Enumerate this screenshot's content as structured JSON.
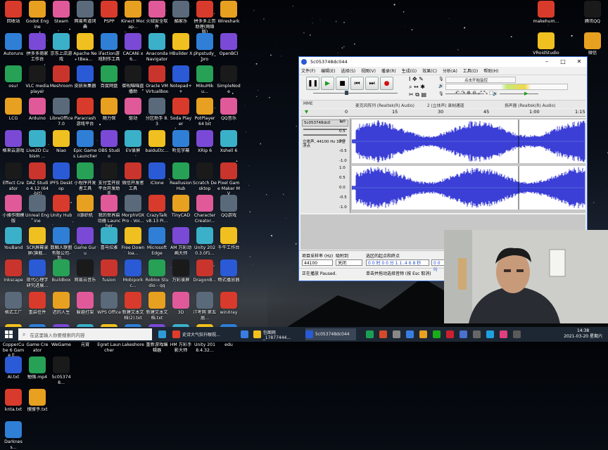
{
  "desktop_icons": [
    [
      "回收站",
      "Autoruns",
      "osu!",
      "LCG",
      "格来云游戏",
      "Effect Creator",
      "小雅作图模版",
      "YouBand",
      "Inkscape",
      "格式工厂",
      "CopperCube 6 Game E...",
      "AI.txt",
      "knta.txt",
      "Darkness..."
    ],
    [
      "Godot Engine",
      "拼多多商家工作台",
      "VLC media player",
      "Arduino",
      "Live2D Cubism ...",
      "DAZ Studio 4.12 (64-bit)",
      "Unreal Engine",
      "SCR屏幕录屏(旗舰...",
      "现代心理学研究进展...",
      "重启任件",
      "Game Creator",
      "勉强.mp4",
      "搜搜予.txt"
    ],
    [
      "Steam",
      "京东上店游戏",
      "Meshroom",
      "LibreOffice 7.0",
      "Niao",
      "IPFS Desktop",
      "Unity Hub",
      "数触人联盟有限公司-加...",
      "Buildbox",
      "迟的人生",
      "WeGame",
      "5c053748..."
    ],
    [
      "网易有道词典",
      "Apache NetBea...",
      "皮肤采集器",
      "Paracrash游戏平台",
      "Epic Games Launcher",
      "小程序开发者工具",
      "II源织机",
      "Game Guru",
      "网易云音乐",
      "躲避打架",
      "元宵"
    ],
    [
      "PSPP",
      "iFaction游戏制作工具",
      "百度网盘",
      "随力保",
      "OBS Studio",
      "支付宝开放平台开发助手",
      "我的世界启动器 Launcher",
      "喜马拉雅",
      "fusion",
      "WPS Office",
      "Egret Launcher"
    ],
    [
      "Kinect Mocap...",
      "CACANi x6...",
      "御视喵喵直播助",
      "驱动",
      "EV录屏",
      "微信开发者工具",
      "MorphVOX Pro - Voi...",
      "Free Downloa...",
      "Mobiporkc...",
      "新建文本文档(2).txt",
      "Lakeshore"
    ],
    [
      "火绒安全软件",
      "Anaconda Navigator",
      "Oracle VM VirtualBox",
      "分区助手 8.3",
      "baiduEtc...",
      "iClone",
      "CrazyTalk v8.13 Pi...",
      "Microsoft Edge",
      "Roblox Studio - qq",
      "新建文本文档.txt",
      "重新游戏编辑器"
    ],
    [
      "酷家乐",
      "HBuilder X",
      "Notepad++",
      "Soda Player",
      "听见字幕",
      "Reallusion Hub",
      "TinyCAD",
      "AM 万彩动画大师",
      "万彩录屏",
      "3D",
      "HM 万彩手影大师"
    ],
    [
      "拼多多上页助理(网络版)",
      "phpstudy_pro",
      "MikuMiku...",
      "PotPlayer 64 bit",
      "XRip 6",
      "Scratch Desktop",
      "Character Creator...",
      "Unity 2020.3.0f1...",
      "DragonB...",
      "iT考网 第五届...",
      "Unity 2018.4.32..."
    ],
    [
      "Wireshark",
      "OpenBCI",
      "SimpleNode",
      "QQ音乐",
      "Xshell 6",
      "Pixel Game Maker MV",
      "QQ游戏",
      "千牛工作台",
      "畅式播放器",
      "winXray",
      "edu"
    ]
  ],
  "right_icons": [
    "makehum...",
    "腾讯QQ",
    "VRoidStudio",
    "微信"
  ],
  "aud": {
    "title": "5c053748dc044",
    "menus": [
      "文件(F)",
      "编辑(E)",
      "选择(S)",
      "视图(V)",
      "播录(R)",
      "生成(G)",
      "效果(C)",
      "分析(A)",
      "工具(O)",
      "帮助(H)"
    ],
    "host": "MME",
    "rec_dev": "麦克风阵列 (Realtek(R) Audio)",
    "rec_ch": "2 (立体声) 录制通道",
    "play_dev": "扬声器 (Realtek(R) Audio)",
    "meter_label": "点击开始监控",
    "ruler": [
      "0",
      "15",
      "30",
      "45",
      "1:00",
      "1:15"
    ],
    "track_name": "5c053748dc0",
    "track_info": "立体声, 44100 Hz 32位浮点",
    "scale": [
      "1.0",
      "0.5",
      "0.0",
      "-0.5",
      "-1.0"
    ],
    "rate_label": "项目采样率 (Hz)",
    "rate_value": "44100",
    "snap_label": "吸附到",
    "snap_value": "关闭",
    "sel_label": "选区的起点和终点",
    "sel_start": "0 0 时 0 0 分 1 1 .4 6 8 秒",
    "sel_end": "0 0 时",
    "status_left": "正在播放 Paused.",
    "status_right": "单击并拖动选择音频 (按 Esc 取消)"
  },
  "taskbar": {
    "search": "在这里输入你要搜索的内容",
    "apps": [
      "史诗大气狂升眼视...",
      "包图网_17877444...",
      "5c053748dc044"
    ],
    "time": "14:38",
    "date": "2021-03-20 星期六"
  },
  "colors": {
    "wave": "#3b3fd6",
    "selection": "#8ea6dc",
    "accent": "#3b6fd6"
  }
}
